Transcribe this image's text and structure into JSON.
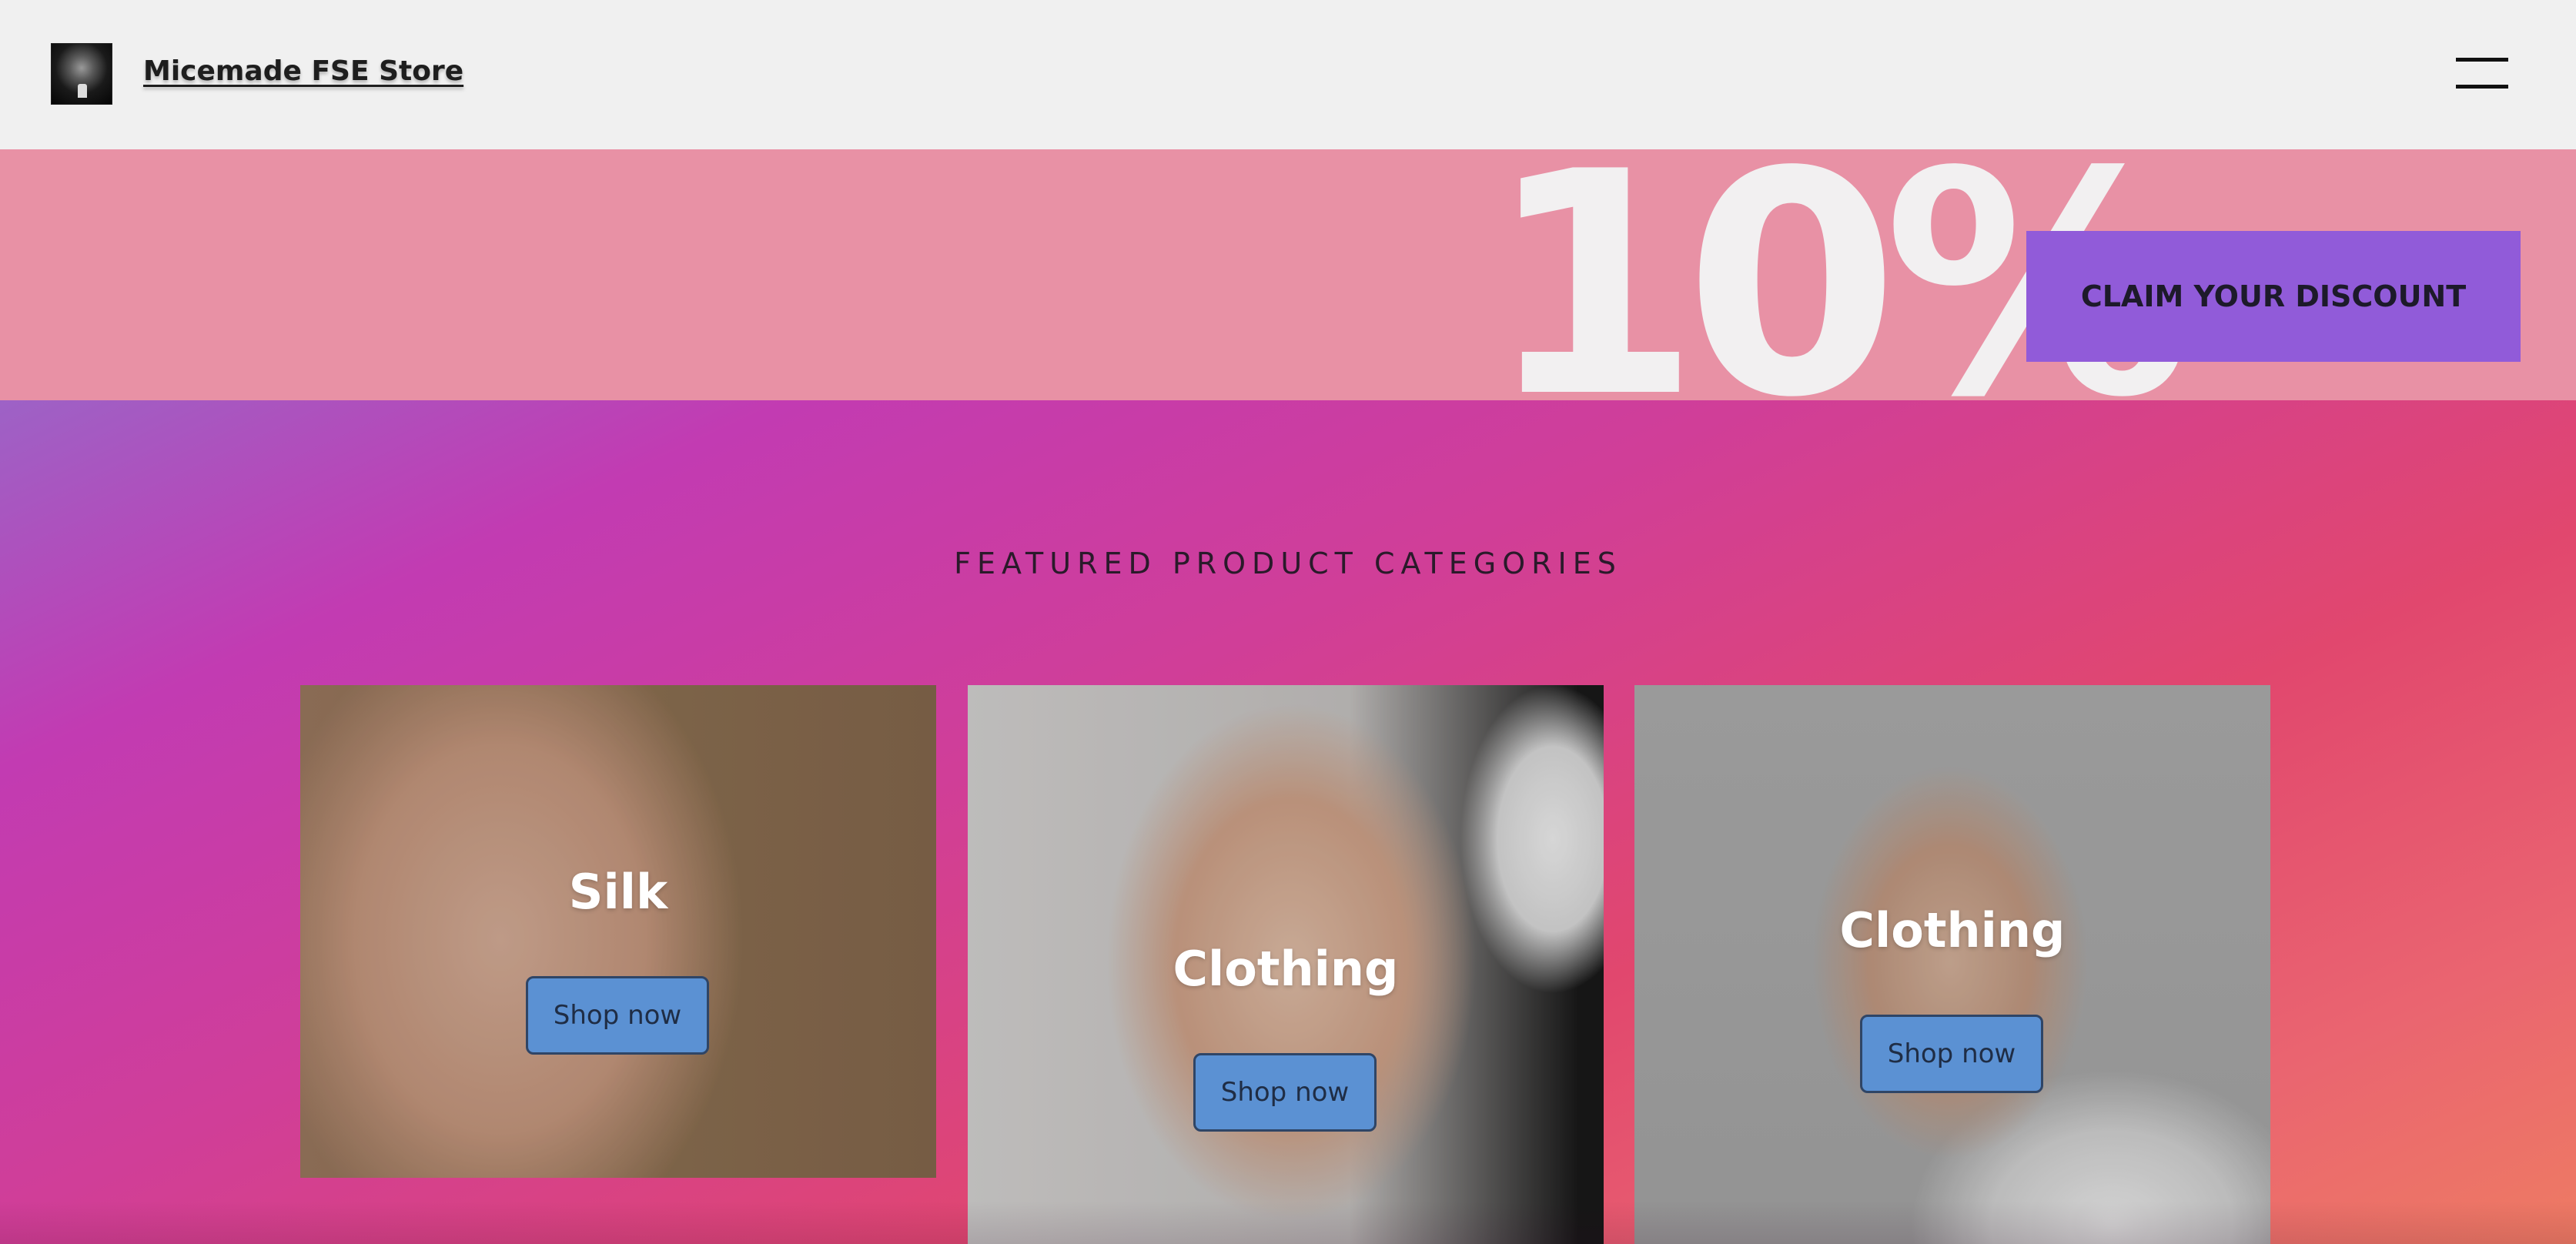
{
  "header": {
    "site_title": "Micemade FSE Store",
    "logo_icon": "store-logo-icon",
    "menu_icon": "hamburger-menu-icon"
  },
  "promo": {
    "percent": "10%",
    "claim_label": "CLAIM YOUR DISCOUNT",
    "background_color": "#e891a5",
    "button_color": "#915bd9"
  },
  "featured": {
    "heading": "FEATURED PRODUCT CATEGORIES",
    "categories": [
      {
        "title": "Silk",
        "button_label": "Shop now"
      },
      {
        "title": "Clothing",
        "button_label": "Shop now"
      },
      {
        "title": "Clothing",
        "button_label": "Shop now"
      }
    ],
    "button_color": "#5b91d3"
  }
}
